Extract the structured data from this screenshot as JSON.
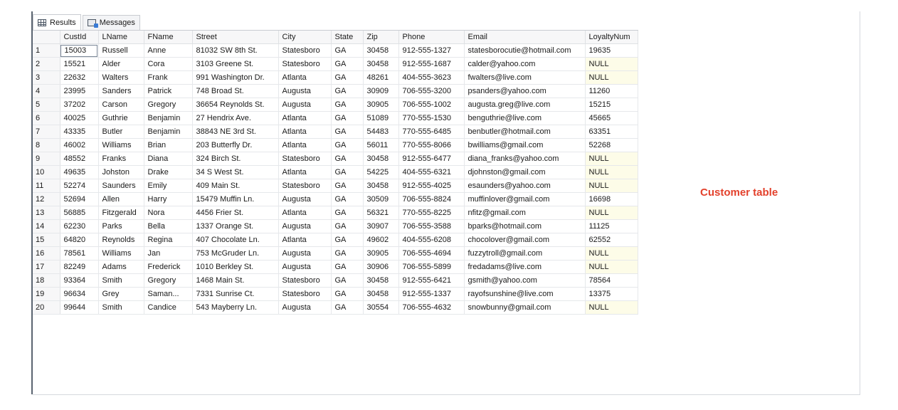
{
  "tabs": [
    {
      "label": "Results",
      "icon": "grid-icon"
    },
    {
      "label": "Messages",
      "icon": "messages-icon"
    }
  ],
  "columns": [
    "",
    "CustId",
    "LName",
    "FName",
    "Street",
    "City",
    "State",
    "Zip",
    "Phone",
    "Email",
    "LoyaltyNum"
  ],
  "rows": [
    [
      "1",
      "15003",
      "Russell",
      "Anne",
      "81032 SW 8th St.",
      "Statesboro",
      "GA",
      "30458",
      "912-555-1327",
      "statesborocutie@hotmail.com",
      "19635"
    ],
    [
      "2",
      "15521",
      "Alder",
      "Cora",
      "3103 Greene St.",
      "Statesboro",
      "GA",
      "30458",
      "912-555-1687",
      "calder@yahoo.com",
      "NULL"
    ],
    [
      "3",
      "22632",
      "Walters",
      "Frank",
      "991 Washington Dr.",
      "Atlanta",
      "GA",
      "48261",
      "404-555-3623",
      "fwalters@live.com",
      "NULL"
    ],
    [
      "4",
      "23995",
      "Sanders",
      "Patrick",
      "748 Broad St.",
      "Augusta",
      "GA",
      "30909",
      "706-555-3200",
      "psanders@yahoo.com",
      "11260"
    ],
    [
      "5",
      "37202",
      "Carson",
      "Gregory",
      "36654 Reynolds St.",
      "Augusta",
      "GA",
      "30905",
      "706-555-1002",
      "augusta.greg@live.com",
      "15215"
    ],
    [
      "6",
      "40025",
      "Guthrie",
      "Benjamin",
      "27 Hendrix Ave.",
      "Atlanta",
      "GA",
      "51089",
      "770-555-1530",
      "benguthrie@live.com",
      "45665"
    ],
    [
      "7",
      "43335",
      "Butler",
      "Benjamin",
      "38843 NE 3rd St.",
      "Atlanta",
      "GA",
      "54483",
      "770-555-6485",
      "benbutler@hotmail.com",
      "63351"
    ],
    [
      "8",
      "46002",
      "Williams",
      "Brian",
      "203 Butterfly Dr.",
      "Atlanta",
      "GA",
      "56011",
      "770-555-8066",
      "bwilliams@gmail.com",
      "52268"
    ],
    [
      "9",
      "48552",
      "Franks",
      "Diana",
      "324 Birch St.",
      "Statesboro",
      "GA",
      "30458",
      "912-555-6477",
      "diana_franks@yahoo.com",
      "NULL"
    ],
    [
      "10",
      "49635",
      "Johston",
      "Drake",
      "34 S West St.",
      "Atlanta",
      "GA",
      "54225",
      "404-555-6321",
      "djohnston@gmail.com",
      "NULL"
    ],
    [
      "11",
      "52274",
      "Saunders",
      "Emily",
      "409 Main St.",
      "Statesboro",
      "GA",
      "30458",
      "912-555-4025",
      "esaunders@yahoo.com",
      "NULL"
    ],
    [
      "12",
      "52694",
      "Allen",
      "Harry",
      "15479 Muffin Ln.",
      "Augusta",
      "GA",
      "30509",
      "706-555-8824",
      "muffinlover@gmail.com",
      "16698"
    ],
    [
      "13",
      "56885",
      "Fitzgerald",
      "Nora",
      "4456 Frier St.",
      "Atlanta",
      "GA",
      "56321",
      "770-555-8225",
      "nfitz@gmail.com",
      "NULL"
    ],
    [
      "14",
      "62230",
      "Parks",
      "Bella",
      "1337 Orange St.",
      "Augusta",
      "GA",
      "30907",
      "706-555-3588",
      "bparks@hotmail.com",
      "11125"
    ],
    [
      "15",
      "64820",
      "Reynolds",
      "Regina",
      "407 Chocolate Ln.",
      "Atlanta",
      "GA",
      "49602",
      "404-555-6208",
      "chocolover@gmail.com",
      "62552"
    ],
    [
      "16",
      "78561",
      "Williams",
      "Jan",
      "753 McGruder Ln.",
      "Augusta",
      "GA",
      "30905",
      "706-555-4694",
      "fuzzytroll@gmail.com",
      "NULL"
    ],
    [
      "17",
      "82249",
      "Adams",
      "Frederick",
      "1010 Berkley St.",
      "Augusta",
      "GA",
      "30906",
      "706-555-5899",
      "fredadams@live.com",
      "NULL"
    ],
    [
      "18",
      "93364",
      "Smith",
      "Gregory",
      "1468 Main St.",
      "Statesboro",
      "GA",
      "30458",
      "912-555-6421",
      "gsmith@yahoo.com",
      "78564"
    ],
    [
      "19",
      "96634",
      "Grey",
      "Saman...",
      "7331 Sunrise Ct.",
      "Statesboro",
      "GA",
      "30458",
      "912-555-1337",
      "rayofsunshine@live.com",
      "13375"
    ],
    [
      "20",
      "99644",
      "Smith",
      "Candice",
      "543 Mayberry Ln.",
      "Augusta",
      "GA",
      "30554",
      "706-555-4632",
      "snowbunny@gmail.com",
      "NULL"
    ]
  ],
  "caption": "Customer table",
  "colors": {
    "null_cell": "#fdfce8",
    "caption": "#e3412c"
  }
}
